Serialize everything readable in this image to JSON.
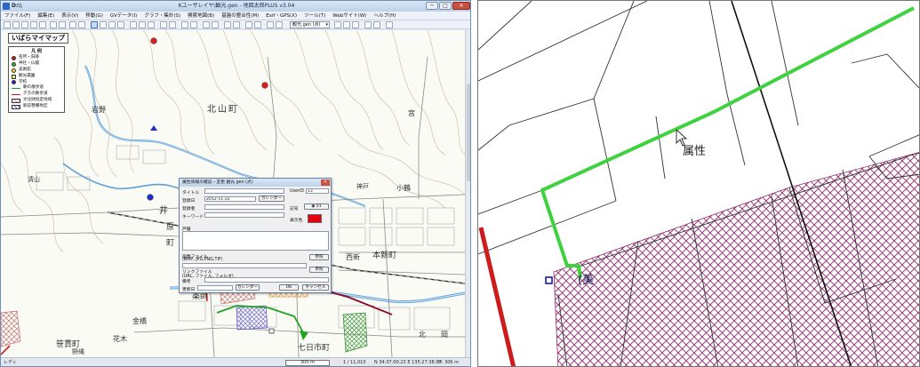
{
  "window": {
    "app_name": "D:\\\\",
    "title": "Kユーザレイヤ\\観光.gen - 地図太郎PLUS v3.04",
    "controls": {
      "minimize": "─",
      "maximize": "□",
      "close": "✕"
    }
  },
  "menu": [
    "ファイル(F)",
    "編集(E)",
    "表示(V)",
    "移動(G)",
    "GVデータ(I)",
    "グラフ・集計(S)",
    "検索地図(B)",
    "基盤の整合性(M)",
    "Exif・GPS(X)",
    "ツール(T)",
    "Webサイト(W)",
    "ヘルプ(H)"
  ],
  "toolbar": {
    "layer_select": "観光.gen (点)"
  },
  "map": {
    "title": "いばらマイマップ",
    "place_names": [
      "北山町",
      "岩野",
      "清山",
      "井",
      "原",
      "町",
      "小鶴",
      "神戸",
      "宮",
      "本新町",
      "西新",
      "薬師",
      "金橋",
      "笹貫町",
      "花木",
      "野縄",
      "七日市町",
      "北",
      "岡"
    ],
    "legend": {
      "title": "凡 例",
      "items": [
        {
          "label": "名所・旧跡",
          "symbol": "dot",
          "color": "#d81e1e"
        },
        {
          "label": "神社・仏閣",
          "symbol": "dot",
          "color": "#2eb82e"
        },
        {
          "label": "美術館",
          "symbol": "dot",
          "color": "#f5e21a"
        },
        {
          "label": "観光農園",
          "symbol": "square",
          "color": "#f2f07a"
        },
        {
          "label": "学校",
          "symbol": "dot",
          "color": "#1f2ccf"
        },
        {
          "label": "朝の散歩道",
          "symbol": "line",
          "color": "#22a322"
        },
        {
          "label": "夕方の散歩道",
          "symbol": "line",
          "color": "#d21d1d"
        },
        {
          "label": "文化財指定地域",
          "symbol": "hatch",
          "color": "#cf8a8a"
        },
        {
          "label": "駅前整備地区",
          "symbol": "hatch",
          "color": "#6a63c7"
        }
      ]
    },
    "scale_label": "300 m"
  },
  "dialog": {
    "title": "属性情報の確認・変更  観光.gen (点)",
    "title_label": "タイトル",
    "userid_label": "UserID",
    "userid_value": "13",
    "date_label": "登録日",
    "date_value": "2012-11-22",
    "calendar_button": "カレンダー",
    "registrant_label": "登録者",
    "keyword_label": "キーワード",
    "symbol_label": "記号",
    "symbol_value": "01",
    "color_label": "表示色",
    "color_value": "#e60012",
    "memo_label": "戸籍",
    "image_label": "画像ファイル",
    "image_hint": "(BMP, JPG,PNG,TIF)",
    "link_label": "リンクファイル",
    "link_hint": "(URL, ファイル, フォルダ)",
    "browse_button": "参照",
    "remark_label": "備考",
    "updated_label": "更新日",
    "updated_calendar": "カレンダー",
    "ok_button": "OK",
    "cancel_button": "キャンセル"
  },
  "status": {
    "ready": "レディ",
    "scale": "1 / 11,010",
    "coords": "N 34:37:00.23  E 135:27:38.07",
    "elevation": "H: 306 m"
  },
  "zoom": {
    "attribute_label": "属性",
    "hatch_label": "(美"
  }
}
